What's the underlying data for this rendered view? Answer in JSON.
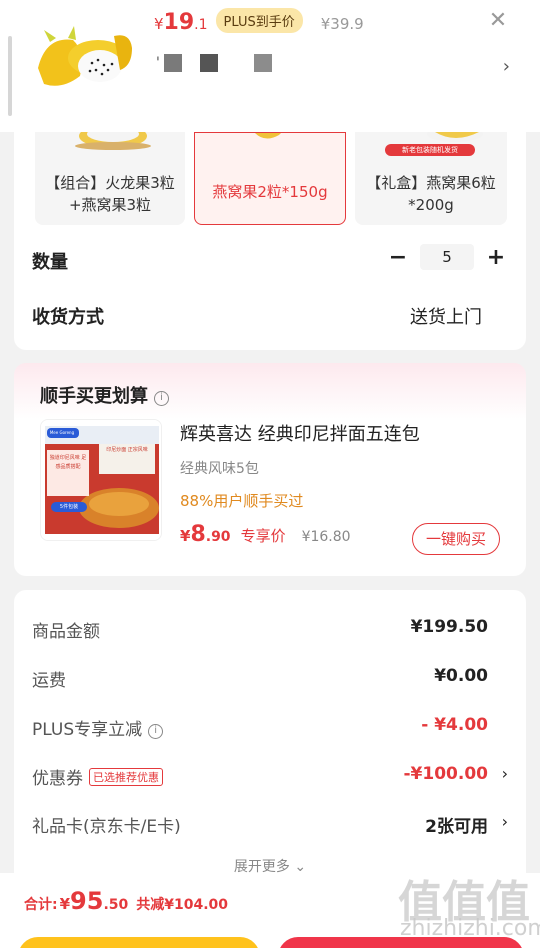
{
  "product": {
    "price_symbol": "¥",
    "price_int": "19",
    "price_dec": ".1",
    "plus_tag": "PLUS到手价",
    "original_price": "¥39.9",
    "spec_prefix": "'"
  },
  "options": [
    {
      "label": "【组合】火龙果3粒+燕窝果3粒",
      "selected": false
    },
    {
      "label": "燕窝果2粒*150g",
      "selected": true
    },
    {
      "label": "【礼盒】燕窝果6粒*200g",
      "selected": false,
      "badge": "新老包装随机发货"
    }
  ],
  "quantity": {
    "label": "数量",
    "minus": "−",
    "value": "5",
    "plus": "+"
  },
  "shipping": {
    "label": "收货方式",
    "value": "送货上门"
  },
  "addon": {
    "title": "顺手买更划算",
    "info_icon": "ⓘ",
    "name": "辉英喜达 经典印尼拌面五连包",
    "spec": "经典风味5包",
    "pct": "88%用户顺手买过",
    "price_symbol": "¥",
    "price_int": "8",
    "price_dec": ".90",
    "exclusive": "专享价",
    "original_price": "¥16.80",
    "buy_button": "一键购买",
    "package_texts": [
      "Mee Goreng",
      "印尼炒面 正宗风味",
      "独道印尼风味 足感品质搭配",
      "5件包装"
    ]
  },
  "summary": {
    "rows": [
      {
        "label": "商品金额",
        "value": "¥199.50"
      },
      {
        "label": "运费",
        "value": "¥0.00"
      },
      {
        "label": "PLUS专享立减",
        "value": "- ¥4.00"
      },
      {
        "label": "优惠券",
        "tag": "已选推荐优惠",
        "value": "-¥100.00"
      },
      {
        "label": "礼品卡(京东卡/E卡)",
        "value": "2张可用"
      }
    ],
    "more": "展开更多 ⌄"
  },
  "footer": {
    "label": "合计:",
    "price_symbol": "¥",
    "price_int": "95",
    "price_dec": ".50",
    "cut": "共减¥104.00"
  },
  "watermark": {
    "glyph": "值值值",
    "site": "zhizhizhi.com"
  },
  "colors": {
    "accent": "#e4393c",
    "plus_bg": "#fbe6a8",
    "yellow": "#ffc21c",
    "red_btn": "#f0354a"
  }
}
